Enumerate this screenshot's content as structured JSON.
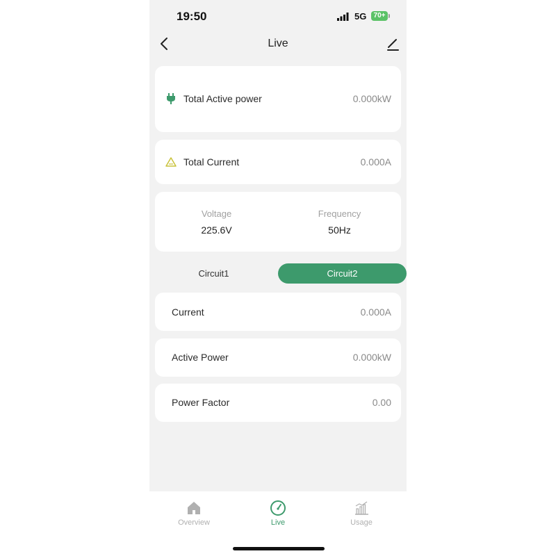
{
  "status_bar": {
    "time": "19:50",
    "network": "5G",
    "battery": "70+"
  },
  "header": {
    "title": "Live"
  },
  "summary": {
    "total_active_power": {
      "label": "Total Active power",
      "value": "0.000kW"
    },
    "total_current": {
      "label": "Total Current",
      "value": "0.000A"
    }
  },
  "grid_stats": {
    "voltage": {
      "label": "Voltage",
      "value": "225.6V"
    },
    "frequency": {
      "label": "Frequency",
      "value": "50Hz"
    }
  },
  "tabs": [
    {
      "label": "Circuit1",
      "active": false
    },
    {
      "label": "Circuit2",
      "active": true
    }
  ],
  "circuit": {
    "current": {
      "label": "Current",
      "value": "0.000A"
    },
    "active_power": {
      "label": "Active Power",
      "value": "0.000kW"
    },
    "power_factor": {
      "label": "Power Factor",
      "value": "0.00"
    }
  },
  "bottom_nav": [
    {
      "label": "Overview",
      "icon": "home-icon",
      "active": false
    },
    {
      "label": "Live",
      "icon": "gauge-icon",
      "active": true
    },
    {
      "label": "Usage",
      "icon": "bar-chart-icon",
      "active": false
    }
  ],
  "colors": {
    "accent": "#3d9a6c",
    "warning_icon": "#c9c23a",
    "inactive_nav": "#b0b0b0",
    "background": "#f2f2f2"
  }
}
